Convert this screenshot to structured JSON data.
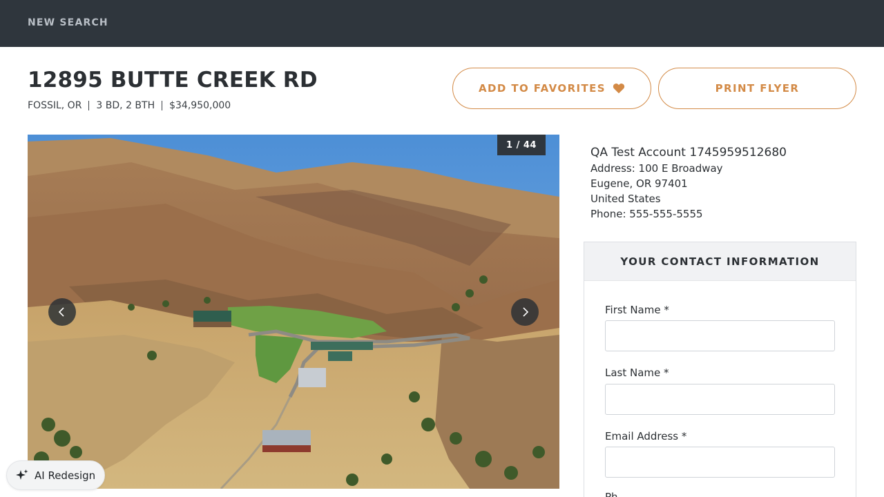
{
  "header": {
    "new_search": "NEW SEARCH"
  },
  "listing": {
    "address": "12895 BUTTE CREEK RD",
    "city": "FOSSIL, OR",
    "beds_baths": "3 BD, 2 BTH",
    "price": "$34,950,000"
  },
  "actions": {
    "favorites": "ADD TO FAVORITES",
    "print": "PRINT FLYER"
  },
  "gallery": {
    "counter": "1 / 44"
  },
  "agent": {
    "name": "QA Test Account 1745959512680",
    "address": "Address: 100 E Broadway",
    "city_line": "Eugene, OR 97401",
    "country": "United States",
    "phone": "Phone: 555-555-5555"
  },
  "contact_form": {
    "title": "YOUR CONTACT INFORMATION",
    "first_name": "First Name *",
    "last_name": "Last Name *",
    "email": "Email Address *",
    "phone_partial": "Ph"
  },
  "ai_badge": {
    "label": "AI Redesign"
  },
  "colors": {
    "accent": "#d38a46",
    "topbar": "#2f363d"
  }
}
